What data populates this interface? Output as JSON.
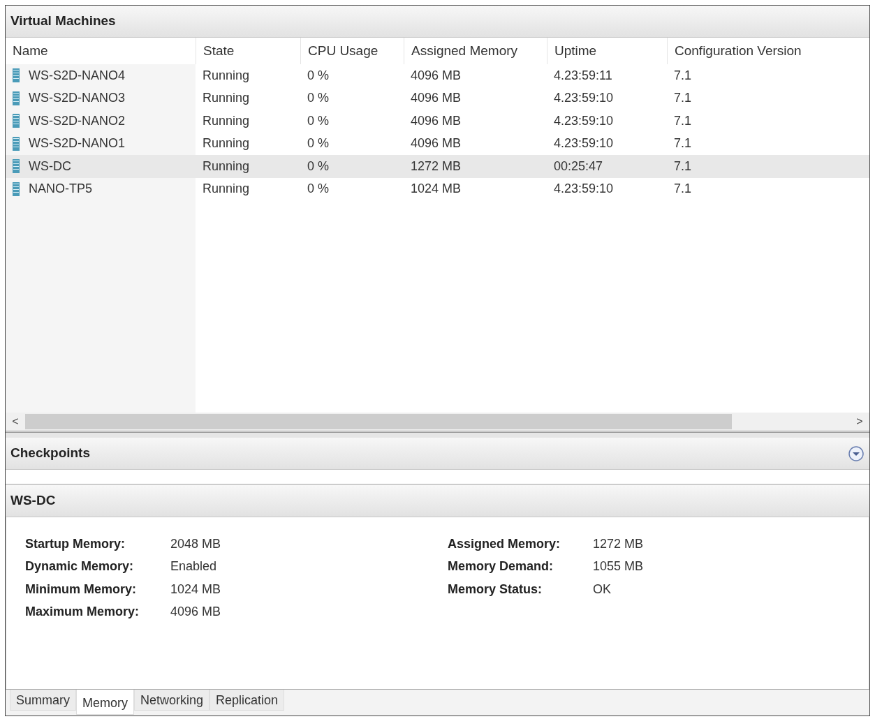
{
  "vm_panel": {
    "title": "Virtual Machines",
    "columns": [
      "Name",
      "State",
      "CPU Usage",
      "Assigned Memory",
      "Uptime",
      "Configuration Version"
    ],
    "rows": [
      {
        "cells": [
          "WS-S2D-NANO4",
          "Running",
          "0 %",
          "4096 MB",
          "4.23:59:11",
          "7.1"
        ],
        "selected": false
      },
      {
        "cells": [
          "WS-S2D-NANO3",
          "Running",
          "0 %",
          "4096 MB",
          "4.23:59:10",
          "7.1"
        ],
        "selected": false
      },
      {
        "cells": [
          "WS-S2D-NANO2",
          "Running",
          "0 %",
          "4096 MB",
          "4.23:59:10",
          "7.1"
        ],
        "selected": false
      },
      {
        "cells": [
          "WS-S2D-NANO1",
          "Running",
          "0 %",
          "4096 MB",
          "4.23:59:10",
          "7.1"
        ],
        "selected": false
      },
      {
        "cells": [
          "WS-DC",
          "Running",
          "0 %",
          "1272 MB",
          "00:25:47",
          "7.1"
        ],
        "selected": true
      },
      {
        "cells": [
          "NANO-TP5",
          "Running",
          "0 %",
          "1024 MB",
          "4.23:59:10",
          "7.1"
        ],
        "selected": false
      }
    ],
    "scroll_left": "<",
    "scroll_right": ">"
  },
  "checkpoints": {
    "title": "Checkpoints",
    "expanded": false
  },
  "details": {
    "title": "WS-DC",
    "left": [
      {
        "label": "Startup Memory:",
        "value": "2048 MB"
      },
      {
        "label": "Dynamic Memory:",
        "value": "Enabled"
      },
      {
        "label": "Minimum Memory:",
        "value": "1024 MB"
      },
      {
        "label": "Maximum Memory:",
        "value": "4096 MB"
      }
    ],
    "right": [
      {
        "label": "Assigned Memory:",
        "value": "1272 MB"
      },
      {
        "label": "Memory Demand:",
        "value": "1055 MB"
      },
      {
        "label": "Memory Status:",
        "value": "OK"
      }
    ],
    "tabs": [
      {
        "label": "Summary",
        "selected": false
      },
      {
        "label": "Memory",
        "selected": true
      },
      {
        "label": "Networking",
        "selected": false
      },
      {
        "label": "Replication",
        "selected": false
      }
    ]
  }
}
